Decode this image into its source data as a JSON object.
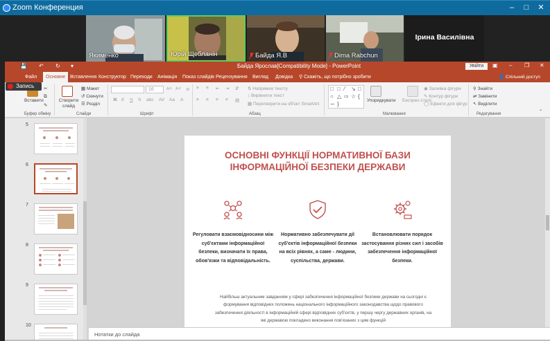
{
  "zoom": {
    "window_title": "Zoom Конференция",
    "recording_label": "Запись"
  },
  "participants": [
    {
      "name": "Якименко"
    },
    {
      "name": "Юрій Щебланін"
    },
    {
      "name": "Байда Я.В"
    },
    {
      "name": "Dima Rabchun"
    },
    {
      "name": "Ірина Василівна"
    }
  ],
  "ppt": {
    "doc_title": "Байда Ярослав[Compatibility Mode] - PowerPoint",
    "sign_in": "Увійти",
    "share": "Спільний доступ",
    "tabs": [
      "Файл",
      "Основне",
      "Вставлення",
      "Конструктор",
      "Переходи",
      "Анімація",
      "Показ слайдів",
      "Рецензування",
      "Вигляд",
      "Довідка"
    ],
    "active_tab": "Основне",
    "tell_me": "Скажіть, що потрібно зробити",
    "groups": {
      "clipboard": "Буфер обміну",
      "slides": "Слайди",
      "font": "Шрифт",
      "paragraph": "Абзац",
      "drawing": "Малювання",
      "editing": "Редагування"
    },
    "buttons": {
      "paste": "Вставити",
      "new_slide": "Створити слайд",
      "layout": "Макет",
      "reset": "Скинути",
      "section": "Розділ",
      "text_direction": "Напрямок тексту",
      "align_text": "Вирівняти текст",
      "smartart": "Перетворити на об'єкт SmartArt",
      "arrange": "Упорядкувати",
      "quick_styles": "Експрес-стилі",
      "shape_fill": "Заливка фігури",
      "shape_outline": "Контур фігури",
      "shape_effects": "Ефекти для фігур",
      "find": "Знайти",
      "replace": "Замінити",
      "select": "Виділити",
      "font_size": "16"
    },
    "thumbnails": [
      {
        "num": "5"
      },
      {
        "num": "6"
      },
      {
        "num": "7"
      },
      {
        "num": "8"
      },
      {
        "num": "9"
      },
      {
        "num": "10"
      }
    ],
    "notes_placeholder": "Нотатки до слайда"
  },
  "slide": {
    "title_line1": "ОСНОВНІ ФУНКЦІЇ НОРМАТИВНОЇ БАЗИ",
    "title_line2": "ІНФОРМАЦІЙНОЇ БЕЗПЕКИ ДЕРЖАВИ",
    "functions": [
      {
        "icon": "people-network-icon",
        "text": "Регуловати взаємовідносини між суб'єктами інформаційної безпеки, визначати їх права, обов'язки та відповідальність."
      },
      {
        "icon": "shield-check-icon",
        "text": "Нормативно забезпечувати дії суб'єктів інформаційної безпеки на всіх рівнях, а саме - людини, суспільства, держави."
      },
      {
        "icon": "gears-settings-icon",
        "text": "Встановлювати порядок застосування різних сил і засобів забезпечення інформаційної безпеки."
      }
    ],
    "body": "Найбільш актуальним завданням у сфері забезпечення інформаційної безпеки держави на сьогодні є формування відповідних положень національного інформаційного законодавства щодо правового забезпечення діяльності в інформаційній сфері відповідних суб'єктів, у першу чергу державних органів, на які державою покладено виконання пов'язаних з цим функцій"
  },
  "colors": {
    "ppt_accent": "#b7472a",
    "slide_title": "#c0504d",
    "zoom_titlebar": "#0f6b9e"
  }
}
